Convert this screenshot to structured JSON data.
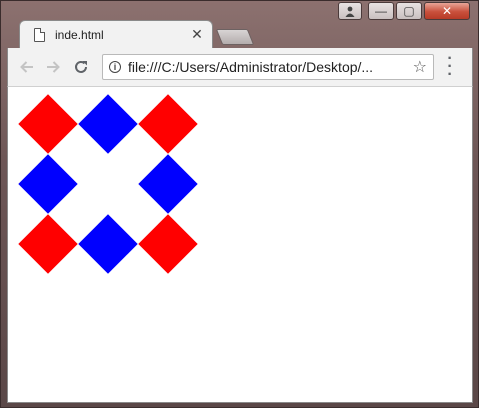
{
  "window": {
    "controls": {
      "profile_icon": "person-icon",
      "minimize": "—",
      "maximize": "▢",
      "close": "✕"
    }
  },
  "tab": {
    "title": "inde.html",
    "close_label": "✕",
    "icon": "page-icon"
  },
  "toolbar": {
    "back_icon": "arrow-left-icon",
    "forward_icon": "arrow-right-icon",
    "reload_icon": "reload-icon",
    "info_icon_label": "i",
    "url": "file:///C:/Users/Administrator/Desktop/...",
    "star_icon": "star-icon",
    "menu_icon": "menu-icon"
  },
  "page": {
    "colors": {
      "red": "#ff0000",
      "blue": "#0000ff"
    },
    "grid": [
      [
        "red",
        "blue",
        "red"
      ],
      [
        "blue",
        "",
        "blue"
      ],
      [
        "red",
        "blue",
        "red"
      ]
    ]
  }
}
